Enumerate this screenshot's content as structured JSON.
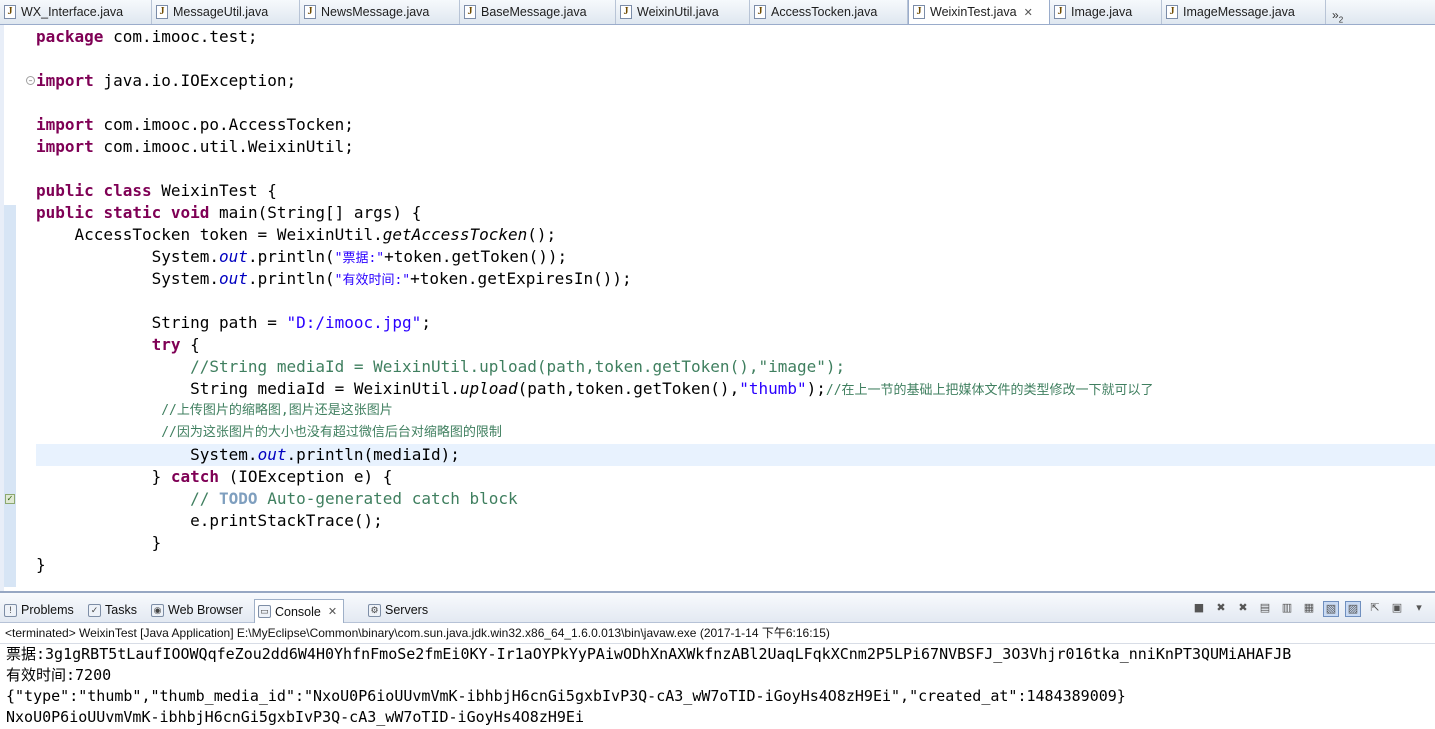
{
  "editor_tabs": [
    {
      "label": "WX_Interface.java",
      "active": false
    },
    {
      "label": "MessageUtil.java",
      "active": false
    },
    {
      "label": "NewsMessage.java",
      "active": false
    },
    {
      "label": "BaseMessage.java",
      "active": false
    },
    {
      "label": "WeixinUtil.java",
      "active": false
    },
    {
      "label": "AccessTocken.java",
      "active": false
    },
    {
      "label": "WeixinTest.java",
      "active": true
    },
    {
      "label": "Image.java",
      "active": false
    },
    {
      "label": "ImageMessage.java",
      "active": false
    }
  ],
  "tab_overflow": {
    "label": "»",
    "count": "2"
  },
  "code": {
    "l1_kw": "package",
    "l1_rest": " com.imooc.test;",
    "l3_kw": "import",
    "l3_rest": " java.io.IOException;",
    "l5_kw": "import",
    "l5_rest": " com.imooc.po.AccessTocken;",
    "l6_kw": "import",
    "l6_rest": " com.imooc.util.WeixinUtil;",
    "l8_kw1": "public",
    "l8_kw2": "class",
    "l8_rest": " WeixinTest {",
    "l9_kw1": "public",
    "l9_kw2": "static",
    "l9_kw3": "void",
    "l9_rest": " main(String[] args) {",
    "l10_a": "    AccessTocken token = WeixinUtil.",
    "l10_m": "getAccessTocken",
    "l10_b": "();",
    "l11_a": "            System.",
    "l11_f": "out",
    "l11_b": ".println(",
    "l11_s": "\"票据:\"",
    "l11_c": "+token.getToken());",
    "l12_a": "            System.",
    "l12_f": "out",
    "l12_b": ".println(",
    "l12_s": "\"有效时间:\"",
    "l12_c": "+token.getExpiresIn());",
    "l14_a": "            String path = ",
    "l14_s": "\"D:/imooc.jpg\"",
    "l14_b": ";",
    "l15_a": "            ",
    "l15_kw": "try",
    "l15_b": " {",
    "l16_c": "                //String mediaId = WeixinUtil.upload(path,token.getToken(),\"image\");",
    "l17_a": "                String mediaId = WeixinUtil.",
    "l17_m": "upload",
    "l17_b": "(path,token.getToken(),",
    "l17_s": "\"thumb\"",
    "l17_c": ");",
    "l17_com": "//在上一节的基础上把媒体文件的类型修改一下就可以了",
    "l18_c": "                //上传图片的缩略图,图片还是这张图片",
    "l19_c": "                //因为这张图片的大小也没有超过微信后台对缩略图的限制",
    "l20_a": "                System.",
    "l20_f": "out",
    "l20_b": ".println(mediaId);",
    "l21_a": "            } ",
    "l21_kw": "catch",
    "l21_b": " (IOException e) {",
    "l22_a": "                ",
    "l22_c1": "// ",
    "l22_todo": "TODO",
    "l22_c2": " Auto-generated catch block",
    "l23_a": "                e.printStackTrace();",
    "l24_a": "            }",
    "l25_a": "}"
  },
  "view_tabs": [
    {
      "label": "Problems",
      "icon": "problems-icon"
    },
    {
      "label": "Tasks",
      "icon": "tasks-icon"
    },
    {
      "label": "Web Browser",
      "icon": "web-browser-icon"
    },
    {
      "label": "Console",
      "icon": "console-icon",
      "active": true
    },
    {
      "label": "Servers",
      "icon": "servers-icon"
    }
  ],
  "console": {
    "status": "<terminated> WeixinTest [Java Application] E:\\MyEclipse\\Common\\binary\\com.sun.java.jdk.win32.x86_64_1.6.0.013\\bin\\javaw.exe (2017-1-14 下午6:16:15)",
    "lines": [
      "票据:3g1gRBT5tLaufIOOWQqfeZou2dd6W4H0YhfnFmoSe2fmEi0KY-Ir1aOYPkYyPAiwODhXnAXWkfnzABl2UaqLFqkXCnm2P5LPi67NVBSFJ_3O3Vhjr016tka_nniKnPT3QUMiAHAFJB",
      "有效时间:7200",
      "{\"type\":\"thumb\",\"thumb_media_id\":\"NxoU0P6ioUUvmVmK-ibhbjH6cnGi5gxbIvP3Q-cA3_wW7oTID-iGoyHs4O8zH9Ei\",\"created_at\":1484389009}",
      "NxoU0P6ioUUvmVmK-ibhbjH6cnGi5gxbIvP3Q-cA3_wW7oTID-iGoyHs4O8zH9Ei"
    ]
  }
}
